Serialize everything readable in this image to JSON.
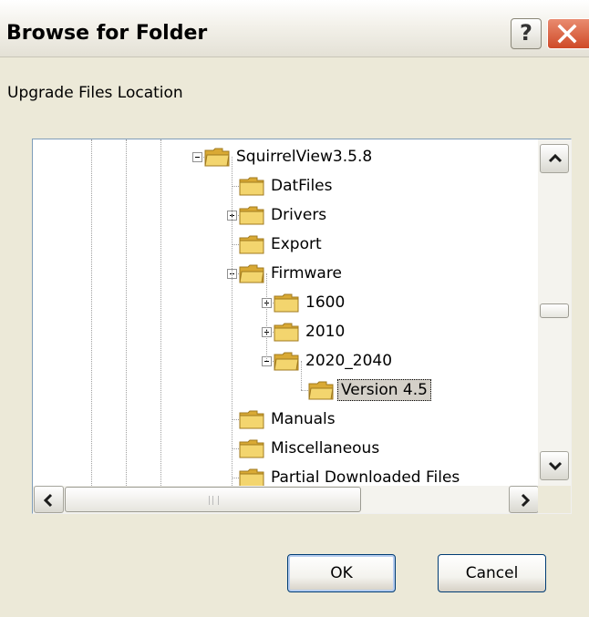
{
  "window": {
    "title": "Browse for Folder"
  },
  "title_buttons": {
    "help": "?",
    "close": "close"
  },
  "prompt": "Upgrade Files Location",
  "tree": {
    "nodes": [
      {
        "label": "SquirrelView3.5.8",
        "expander": "minus"
      },
      {
        "label": "DatFiles",
        "expander": "none"
      },
      {
        "label": "Drivers",
        "expander": "plus"
      },
      {
        "label": "Export",
        "expander": "none"
      },
      {
        "label": "Firmware",
        "expander": "minus"
      },
      {
        "label": "1600",
        "expander": "plus"
      },
      {
        "label": "2010",
        "expander": "plus"
      },
      {
        "label": "2020_2040",
        "expander": "minus"
      },
      {
        "label": "Version 4.5",
        "expander": "none",
        "selected": true
      },
      {
        "label": "Manuals",
        "expander": "none"
      },
      {
        "label": "Miscellaneous",
        "expander": "none"
      },
      {
        "label": "Partial Downloaded Files",
        "expander": "none"
      }
    ]
  },
  "buttons": {
    "ok": "OK",
    "cancel": "Cancel"
  },
  "colors": {
    "folder": "#f3d56e",
    "selection": "#d4d0c8",
    "close": "#d4572f",
    "border": "#7f9db9"
  }
}
